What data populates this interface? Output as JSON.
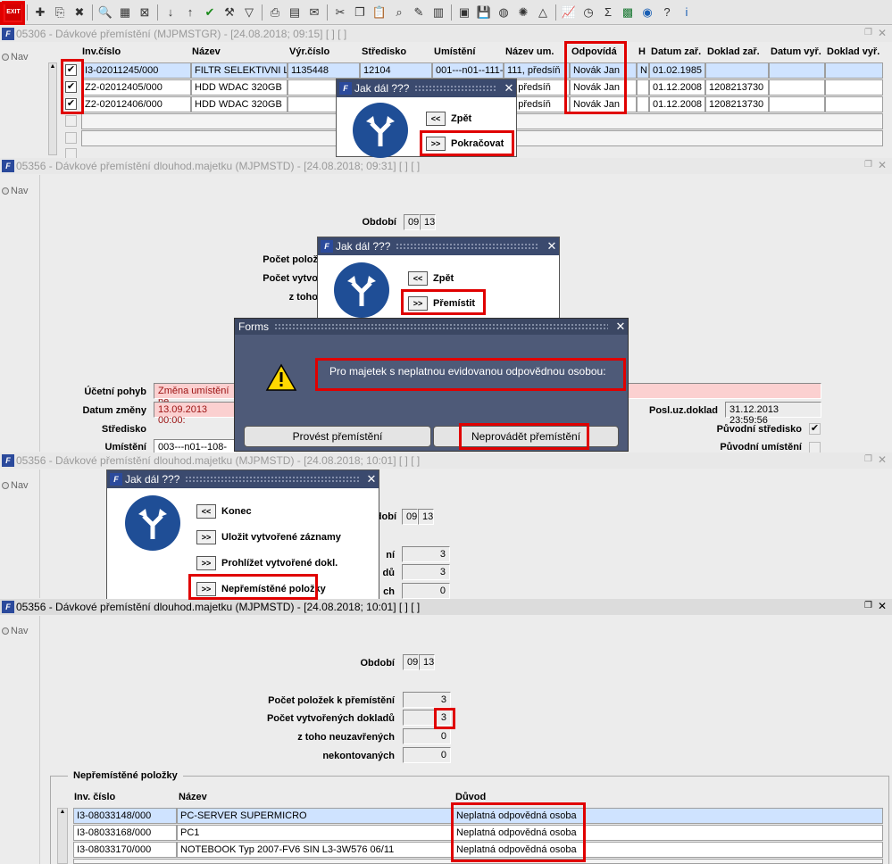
{
  "toolbar": {
    "exit_label": "EXIT"
  },
  "win1": {
    "title": "05306 - Dávkové přemístění (MJPMSTGR) - [24.08.2018; 09:15]  [ ]  [ ]",
    "nav": "Nav",
    "headers": [
      "Inv.číslo",
      "Název",
      "Výr.číslo",
      "Středisko",
      "Umístění",
      "Název um.",
      "Odpovídá",
      "H",
      "Datum zař.",
      "Doklad zař.",
      "Datum vyř.",
      "Doklad vyř."
    ],
    "rows": [
      [
        "I3-02011245/000",
        "FILTR SELEKTIVNI L",
        "1135448",
        "12104",
        "001---n01--111-",
        "111, předsíň",
        "Novák Jan",
        "N",
        "01.02.1985",
        "",
        "",
        ""
      ],
      [
        "Z2-02012405/000",
        "HDD WDAC 320GB",
        "",
        "",
        "",
        "1, předsíň",
        "Novák Jan",
        "",
        "01.12.2008",
        "1208213730",
        "",
        ""
      ],
      [
        "Z2-02012406/000",
        "HDD WDAC 320GB",
        "",
        "",
        "",
        "1, předsíň",
        "Novák Jan",
        "",
        "01.12.2008",
        "1208213730",
        "",
        ""
      ]
    ],
    "dialog": {
      "title": "Jak dál ???",
      "btn_back_icon": "<<",
      "btn_back": "Zpět",
      "btn_next_icon": ">>",
      "btn_next": "Pokračovat"
    }
  },
  "win2": {
    "title": "05356 - Dávkové přemístění dlouhod.majetku (MJPMSTD) - [24.08.2018; 09:31]  [ ]  [ ]",
    "nav": "Nav",
    "obdobi_label": "Období",
    "obdobi_a": "09",
    "obdobi_b": "13",
    "pocet_label": "Počet polož",
    "vytv_label": "Počet vytvo",
    "ztoho_label": "z toho",
    "ucetni_label": "Účetní pohyb",
    "ucetni_value": "Změna umístění ne",
    "datum_label": "Datum změny",
    "datum_value": "13.09.2013 00:00:",
    "stredisko_label": "Středisko",
    "umisteni_label": "Umístění",
    "umisteni_value": "003---n01--108-",
    "posl_label": "Posl.uz.doklad",
    "posl_value": "31.12.2013 23:59:56",
    "puv_str_label": "Původní středisko",
    "puv_um_label": "Původní umístění",
    "dialog": {
      "title": "Jak dál ???",
      "btn_back_icon": "<<",
      "btn_back": "Zpět",
      "btn_next_icon": ">>",
      "btn_next": "Přemístit"
    },
    "forms": {
      "title": "Forms",
      "message": "Pro majetek s neplatnou evidovanou odpovědnou osobou:",
      "btn_do": "Provést přemístění",
      "btn_dont": "Neprovádět přemístění"
    }
  },
  "win3": {
    "title": "05356 - Dávkové přemístění dlouhod.majetku (MJPMSTD) - [24.08.2018; 10:01]  [ ]  [ ]",
    "nav": "Nav",
    "obdobi_label": "bdobí",
    "obdobi_a": "09",
    "obdobi_b": "13",
    "lbl1": "ní",
    "lbl2": "dů",
    "lbl3": "ch",
    "v1": "3",
    "v2": "3",
    "v3": "0",
    "dialog": {
      "title": "Jak dál ???",
      "items": [
        {
          "icon": "<<",
          "label": "Konec"
        },
        {
          "icon": ">>",
          "label": "Uložit vytvořené záznamy"
        },
        {
          "icon": ">>",
          "label": "Prohlížet vytvořené dokl."
        },
        {
          "icon": ">>",
          "label": "Nepřemístěné položky"
        }
      ]
    }
  },
  "win4": {
    "title": "05356 - Dávkové přemístění dlouhod.majetku (MJPMSTD) - [24.08.2018; 10:01]  [ ]  [ ]",
    "nav": "Nav",
    "obdobi_label": "Období",
    "obdobi_a": "09",
    "obdobi_b": "13",
    "pocet_label": "Počet položek k přemístění",
    "pocet_value": "3",
    "vytv_label": "Počet vytvořených dokladů",
    "vytv_value": "3",
    "ztoho_label": "z toho    neuzavřených",
    "ztoho_value": "0",
    "nekont_label": "nekontovaných",
    "nekont_value": "0",
    "group_title": "Nepřemístěné položky",
    "headers": [
      "Inv. číslo",
      "Název",
      "Důvod"
    ],
    "rows": [
      [
        "I3-08033148/000",
        "PC-SERVER SUPERMICRO",
        "Neplatná odpovědná osoba"
      ],
      [
        "I3-08033168/000",
        "PC1",
        "Neplatná odpovědná osoba"
      ],
      [
        "I3-08033170/000",
        "NOTEBOOK Typ 2007-FV6 SIN L3-3W576 06/11",
        "Neplatná odpovědná osoba"
      ]
    ]
  }
}
